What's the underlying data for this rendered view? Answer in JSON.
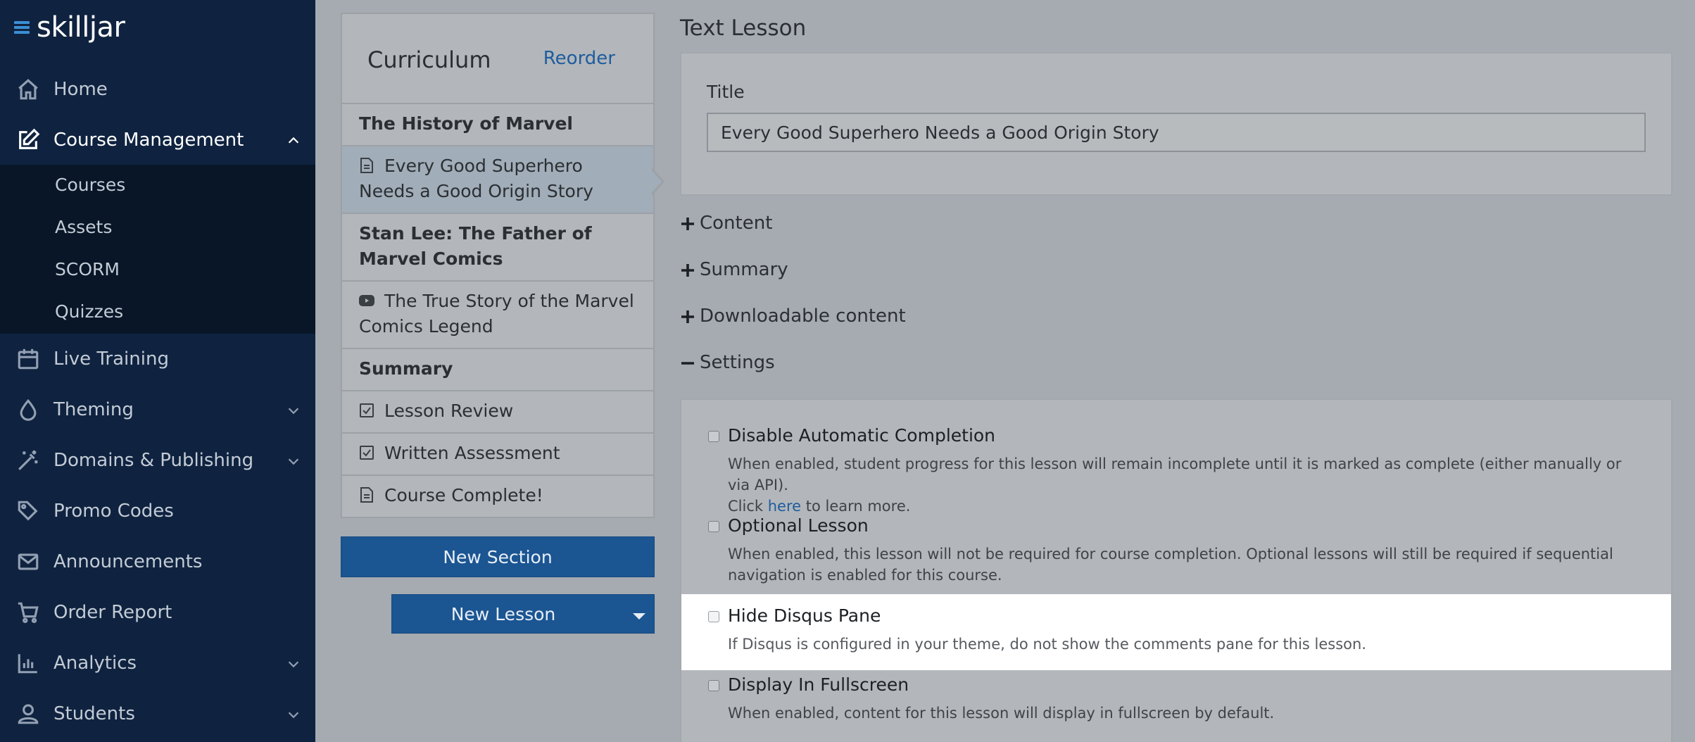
{
  "brand": {
    "logo_text": "skilljar"
  },
  "sidebar": {
    "items": [
      {
        "label": "Home",
        "icon": "home-icon"
      },
      {
        "label": "Course Management",
        "icon": "edit-icon",
        "expanded": true
      },
      {
        "label": "Live Training",
        "icon": "calendar-icon"
      },
      {
        "label": "Theming",
        "icon": "droplet-icon"
      },
      {
        "label": "Domains & Publishing",
        "icon": "magic-wand-icon"
      },
      {
        "label": "Promo Codes",
        "icon": "tags-icon"
      },
      {
        "label": "Announcements",
        "icon": "envelope-icon"
      },
      {
        "label": "Order Report",
        "icon": "cart-icon"
      },
      {
        "label": "Analytics",
        "icon": "bar-chart-icon"
      },
      {
        "label": "Students",
        "icon": "user-icon"
      }
    ],
    "subitems": [
      "Courses",
      "Assets",
      "SCORM",
      "Quizzes"
    ]
  },
  "curriculum": {
    "title": "Curriculum",
    "reorder_label": "Reorder",
    "items": [
      {
        "text": "The History of Marvel",
        "kind": "section"
      },
      {
        "text": "Every Good Superhero Needs a Good Origin Story",
        "kind": "lesson",
        "icon": "document-icon",
        "selected": true
      },
      {
        "text": "Stan Lee: The Father of Marvel Comics",
        "kind": "section"
      },
      {
        "text": "The True Story of the Marvel Comics Legend",
        "kind": "lesson",
        "icon": "video-icon"
      },
      {
        "text": "Summary",
        "kind": "section"
      },
      {
        "text": "Lesson Review",
        "kind": "lesson",
        "icon": "checkbox-icon"
      },
      {
        "text": "Written Assessment",
        "kind": "lesson",
        "icon": "checkbox-icon"
      },
      {
        "text": "Course Complete!",
        "kind": "lesson",
        "icon": "document-icon"
      }
    ],
    "new_section_label": "New Section",
    "new_lesson_label": "New Lesson"
  },
  "editor": {
    "heading": "Text Lesson",
    "title_label": "Title",
    "title_value": "Every Good Superhero Needs a Good Origin Story",
    "accordions": [
      {
        "label": "Content",
        "state": "collapsed"
      },
      {
        "label": "Summary",
        "state": "collapsed"
      },
      {
        "label": "Downloadable content",
        "state": "collapsed"
      },
      {
        "label": "Settings",
        "state": "expanded"
      }
    ],
    "settings": [
      {
        "title": "Disable Automatic Completion",
        "desc_line1": "When enabled, student progress for this lesson will remain incomplete until it is marked as complete (either manually or via API).",
        "desc_prefix": "Click ",
        "desc_link": "here",
        "desc_suffix": " to learn more.",
        "checked": false
      },
      {
        "title": "Optional Lesson",
        "desc": "When enabled, this lesson will not be required for course completion. Optional lessons will still be required if sequential navigation is enabled for this course.",
        "checked": false
      },
      {
        "title": "Hide Disqus Pane",
        "desc": "If Disqus is configured in your theme, do not show the comments pane for this lesson.",
        "checked": false,
        "highlighted": true
      },
      {
        "title": "Display In Fullscreen",
        "desc": "When enabled, content for this lesson will display in fullscreen by default.",
        "checked": false
      }
    ]
  },
  "colors": {
    "sidebar_bg": "#0f2340",
    "subnav_bg": "#081628",
    "overlay_bg": "#a5abb1",
    "primary_button": "#1b5592",
    "link": "#1f5c9e"
  }
}
